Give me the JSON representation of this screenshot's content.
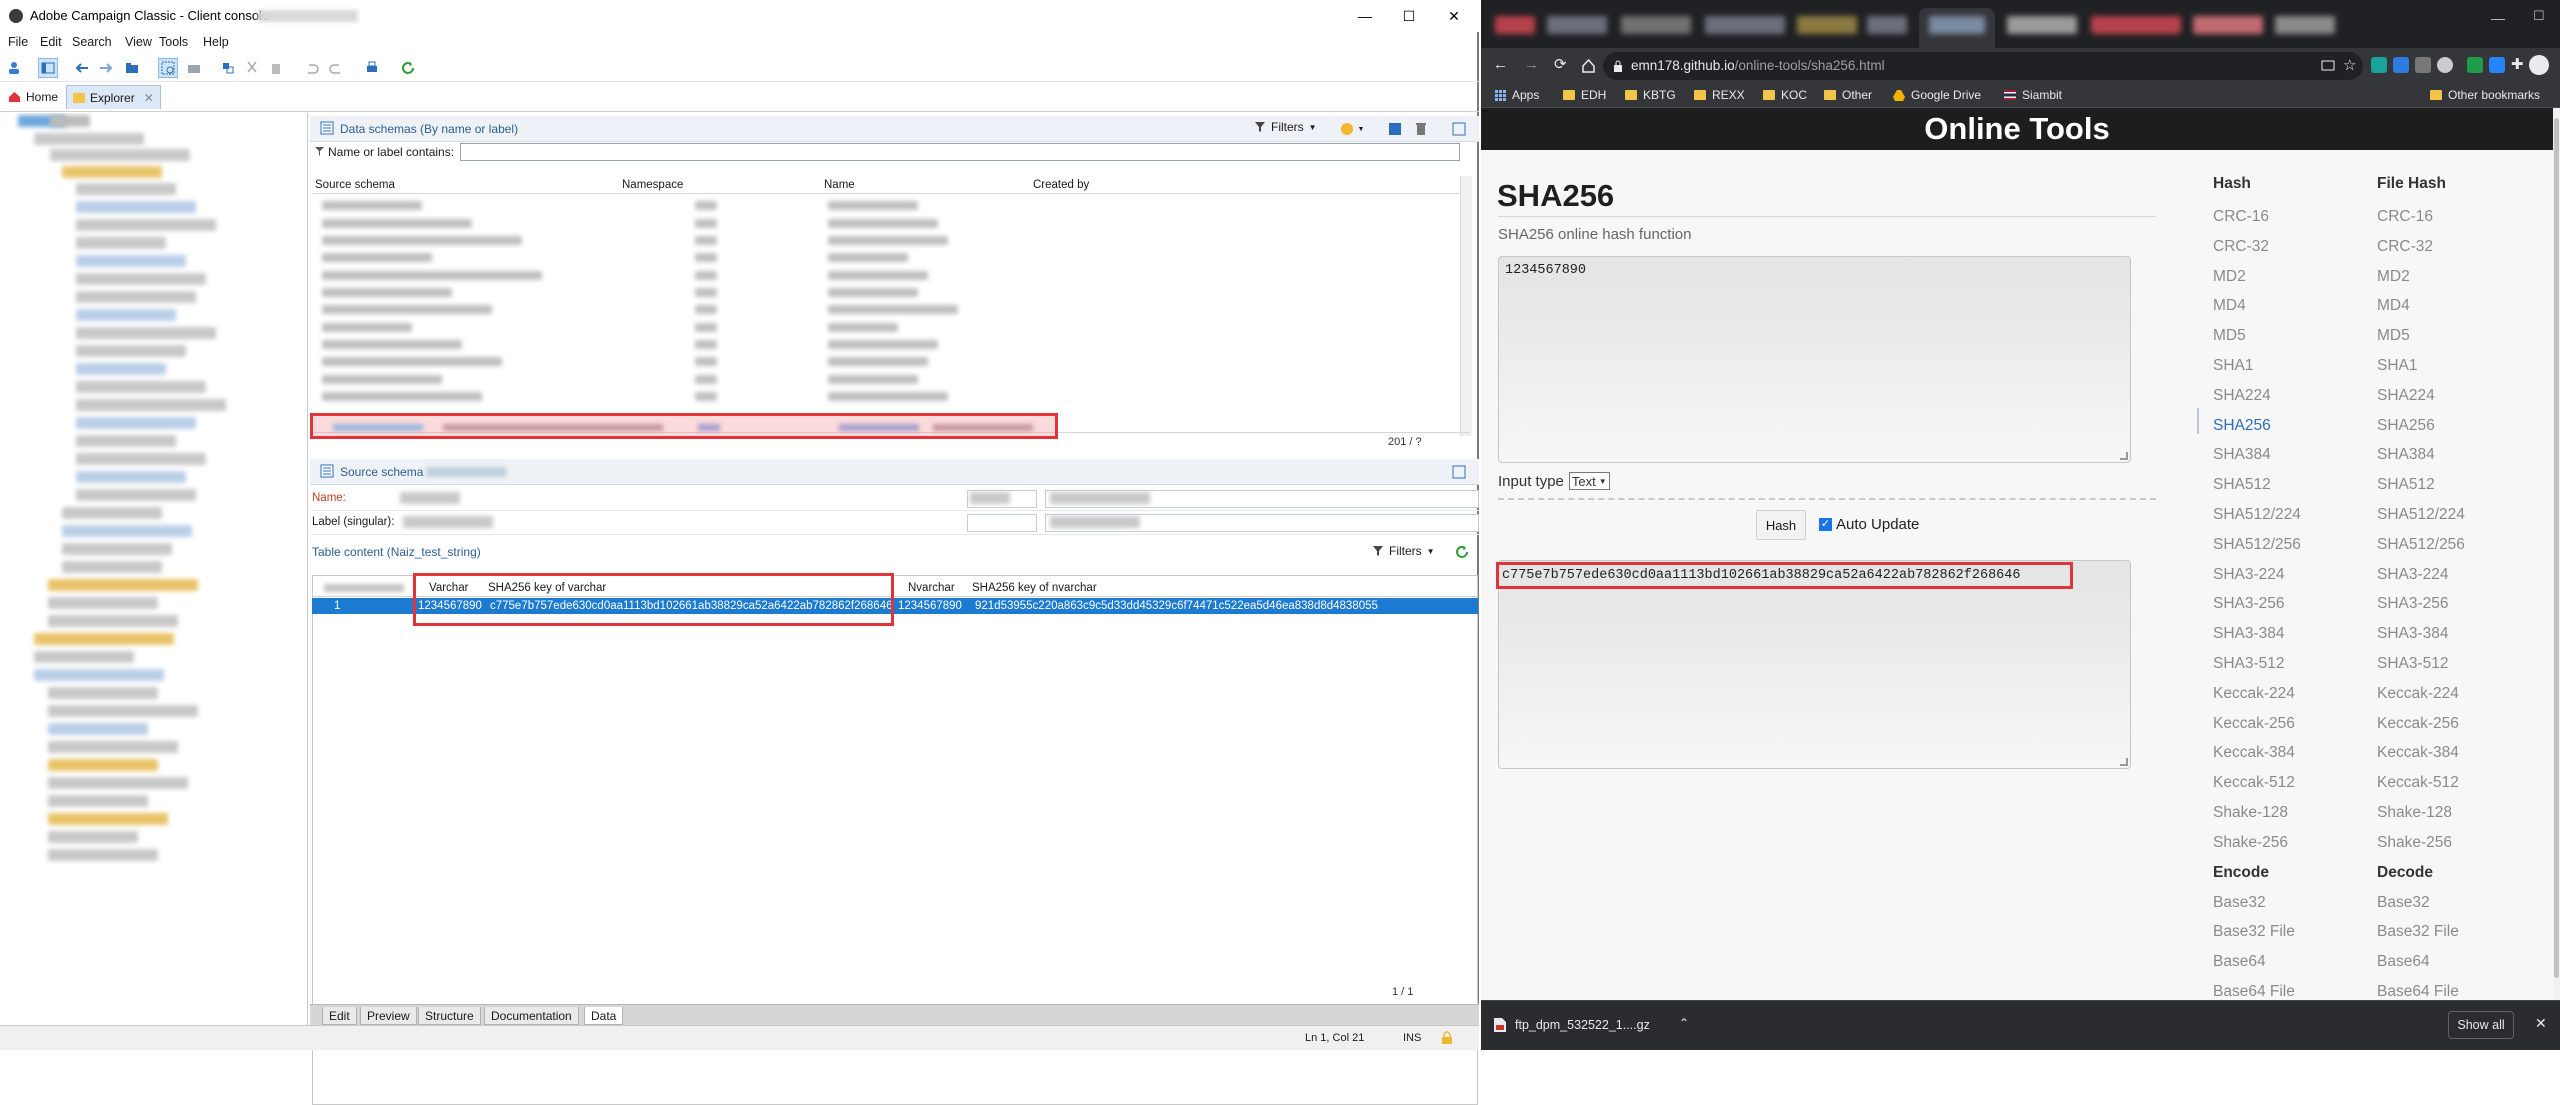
{
  "app": {
    "title": "Adobe Campaign Classic - Client console",
    "menu": [
      "File",
      "Edit",
      "Search",
      "View",
      "Tools",
      "Help"
    ],
    "tabs": {
      "home": "Home",
      "explorer": "Explorer"
    },
    "schemas_panel": {
      "title": "Data schemas (By name or label)",
      "filters_label": "Filters",
      "filter_field_label": "Name or label contains:",
      "filter_value": "",
      "columns": [
        "Source schema",
        "Namespace",
        "Name",
        "Created by"
      ],
      "count": "201 / ?"
    },
    "source_panel": {
      "title": "Source schema",
      "name_label": "Name:",
      "label_label": "Label (singular):"
    },
    "table_content": {
      "title": "Table content (Naiz_test_string)",
      "filters_label": "Filters",
      "columns": [
        "Varchar",
        "SHA256 key of varchar",
        "Nvarchar",
        "SHA256 key of nvarchar"
      ],
      "row": {
        "index": "1",
        "varchar": "1234567890",
        "sha_varchar": "c775e7b757ede630cd0aa1113bd102661ab38829ca52a6422ab782862f268646",
        "nvarchar": "1234567890",
        "sha_nvarchar": "921d53955c220a863c9c5d33dd45329c6f74471c522ea5d46ea838d8d4838055"
      },
      "count": "1 / 1"
    },
    "bottom_tabs": [
      "Edit",
      "Preview",
      "Structure",
      "Documentation",
      "Data"
    ],
    "status": {
      "position": "Ln 1, Col 21",
      "mode": "INS"
    }
  },
  "browser": {
    "url_host": "emn178.github.io",
    "url_path": "/online-tools/sha256.html",
    "bookmarks": [
      "Apps",
      "EDH",
      "KBTG",
      "REXX",
      "KOC",
      "Other",
      "Google Drive",
      "Siambit"
    ],
    "other_bookmarks": "Other bookmarks",
    "download_file": "ftp_dpm_532522_1....gz",
    "show_all": "Show all"
  },
  "page": {
    "site_title": "Online Tools",
    "heading": "SHA256",
    "subtitle": "SHA256 online hash function",
    "input_text": "1234567890",
    "input_type_label": "Input type",
    "input_type_value": "Text",
    "hash_button": "Hash",
    "auto_update_label": "Auto Update",
    "output_hash": "c775e7b757ede630cd0aa1113bd102661ab38829ca52a6422ab782862f268646",
    "nav_hash_header": "Hash",
    "nav_filehash_header": "File Hash",
    "nav_hash": [
      "CRC-16",
      "CRC-32",
      "MD2",
      "MD4",
      "MD5",
      "SHA1",
      "SHA224",
      "SHA256",
      "SHA384",
      "SHA512",
      "SHA512/224",
      "SHA512/256",
      "SHA3-224",
      "SHA3-256",
      "SHA3-384",
      "SHA3-512",
      "Keccak-224",
      "Keccak-256",
      "Keccak-384",
      "Keccak-512",
      "Shake-128",
      "Shake-256"
    ],
    "nav_filehash": [
      "CRC-16",
      "CRC-32",
      "MD2",
      "MD4",
      "MD5",
      "SHA1",
      "SHA224",
      "SHA256",
      "SHA384",
      "SHA512",
      "SHA512/224",
      "SHA512/256",
      "SHA3-224",
      "SHA3-256",
      "SHA3-384",
      "SHA3-512",
      "Keccak-224",
      "Keccak-256",
      "Keccak-384",
      "Keccak-512",
      "Shake-128",
      "Shake-256"
    ],
    "encode_header": "Encode",
    "decode_header": "Decode",
    "nav_encode": [
      "Base32",
      "Base32 File",
      "Base64",
      "Base64 File"
    ],
    "nav_decode": [
      "Base32",
      "Base32 File",
      "Base64",
      "Base64 File"
    ]
  }
}
